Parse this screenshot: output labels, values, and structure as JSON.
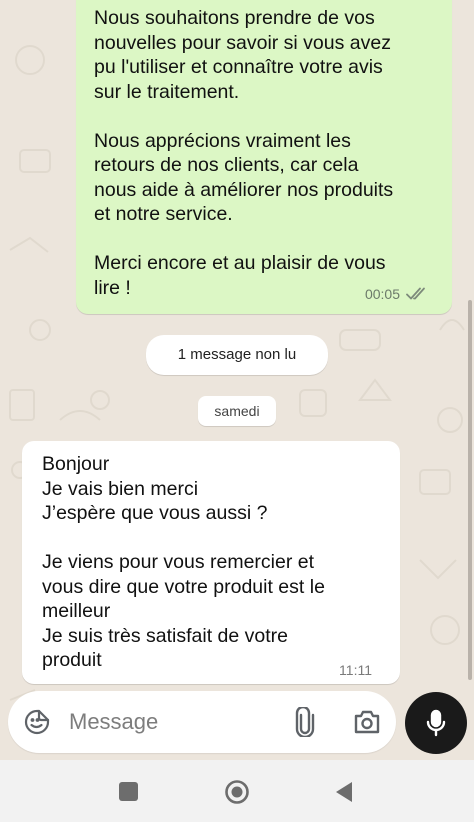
{
  "messages": {
    "outgoing": {
      "text": "Nous souhaitons prendre de vos\nnouvelles pour savoir si vous avez\npu l'utiliser et connaître votre avis\nsur le traitement.\n\nNous apprécions vraiment les\nretours de nos clients, car cela\nnous aide à améliorer nos produits\net notre service.\n\nMerci encore et au plaisir de vous\nlire !",
      "time": "00:05",
      "status_icon": "double-check-icon"
    },
    "unread_banner": "1 message non lu",
    "date_divider": "samedi",
    "incoming": {
      "text": "Bonjour\nJe vais bien merci\nJ’espère que vous aussi ?\n\nJe viens pour vous remercier et\nvous dire que votre produit est le\nmeilleur\nJe suis très satisfait de votre\nproduit",
      "time": "11:11"
    }
  },
  "composer": {
    "placeholder": "Message",
    "icons": [
      "sticker-icon",
      "paperclip-icon",
      "camera-icon",
      "microphone-icon"
    ]
  },
  "navbar": {
    "icons": [
      "recents-square-icon",
      "home-circle-icon",
      "back-triangle-icon"
    ]
  },
  "colors": {
    "outgoing_bubble": "#dcf7c5",
    "incoming_bubble": "#ffffff",
    "chat_background": "#ece5dc",
    "mic_button": "#1a1a1a"
  }
}
